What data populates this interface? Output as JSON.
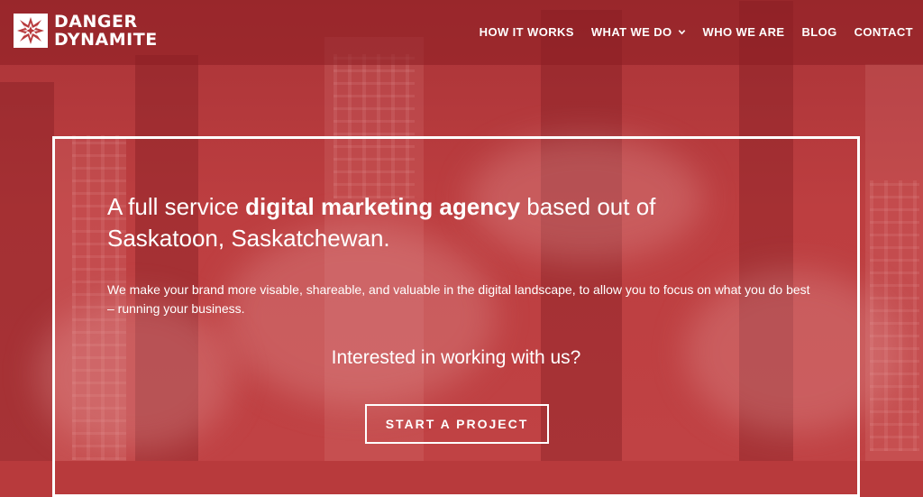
{
  "brand": {
    "line1": "DANGER",
    "line2": "DYNAMITE",
    "logo_icon": "starburst-logo-icon"
  },
  "nav": [
    {
      "label": "HOW IT WORKS",
      "has_dropdown": false
    },
    {
      "label": "WHAT WE DO",
      "has_dropdown": true
    },
    {
      "label": "WHO WE ARE",
      "has_dropdown": false
    },
    {
      "label": "BLOG",
      "has_dropdown": false
    },
    {
      "label": "CONTACT",
      "has_dropdown": false
    }
  ],
  "hero": {
    "headline_part1": "A full service ",
    "headline_bold": "digital marketing agency",
    "headline_part2": " based out of Saskatoon, Saskatchewan.",
    "subtext": "We make your brand more visable, shareable, and valuable in the digital landscape, to allow you to focus on what you do best – running your business.",
    "question": "Interested in working with us?",
    "cta_label": "START A PROJECT"
  },
  "colors": {
    "brand_red": "#b83a3c",
    "text": "#ffffff"
  }
}
